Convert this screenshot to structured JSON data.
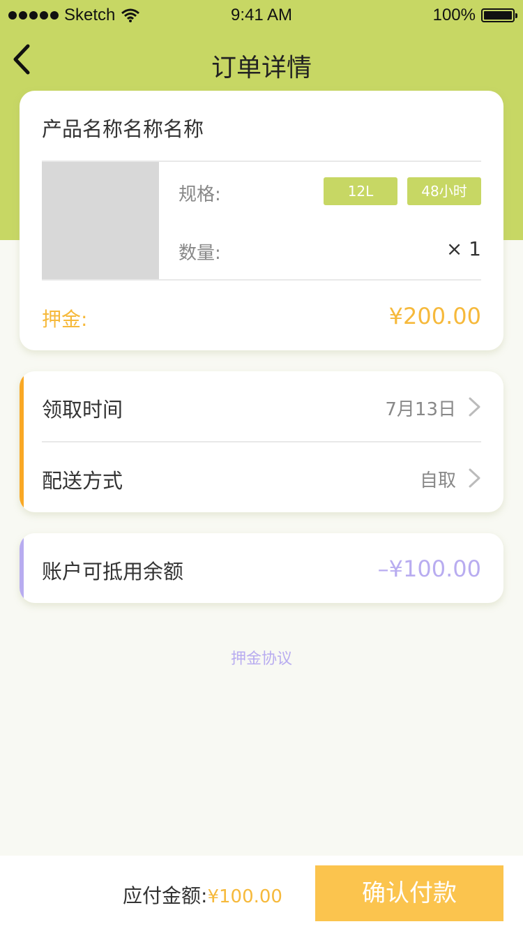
{
  "status_bar": {
    "carrier": "Sketch",
    "time": "9:41 AM",
    "battery": "100%"
  },
  "nav": {
    "title": "订单详情",
    "back_icon": "chevron-left-icon"
  },
  "product": {
    "name": "产品名称名称名称",
    "spec_label": "规格:",
    "spec_tags": [
      "12L",
      "48小时"
    ],
    "qty_label": "数量:",
    "qty_value": "× 1",
    "deposit_label": "押金:",
    "deposit_value": "¥200.00"
  },
  "delivery": {
    "accent_color": "#f9a825",
    "rows": [
      {
        "label": "领取时间",
        "value": "7月13日"
      },
      {
        "label": "配送方式",
        "value": "自取"
      }
    ]
  },
  "credit": {
    "accent_color": "#b8acf0",
    "label": "账户可抵用余额",
    "value": "–¥100.00"
  },
  "agreement_link": "押金协议",
  "footer": {
    "pay_label": "应付金额:",
    "pay_amount": "¥100.00",
    "confirm_label": "确认付款"
  },
  "colors": {
    "header_green": "#c7d764",
    "accent_orange": "#f6b93b",
    "accent_purple": "#b8acf0"
  }
}
